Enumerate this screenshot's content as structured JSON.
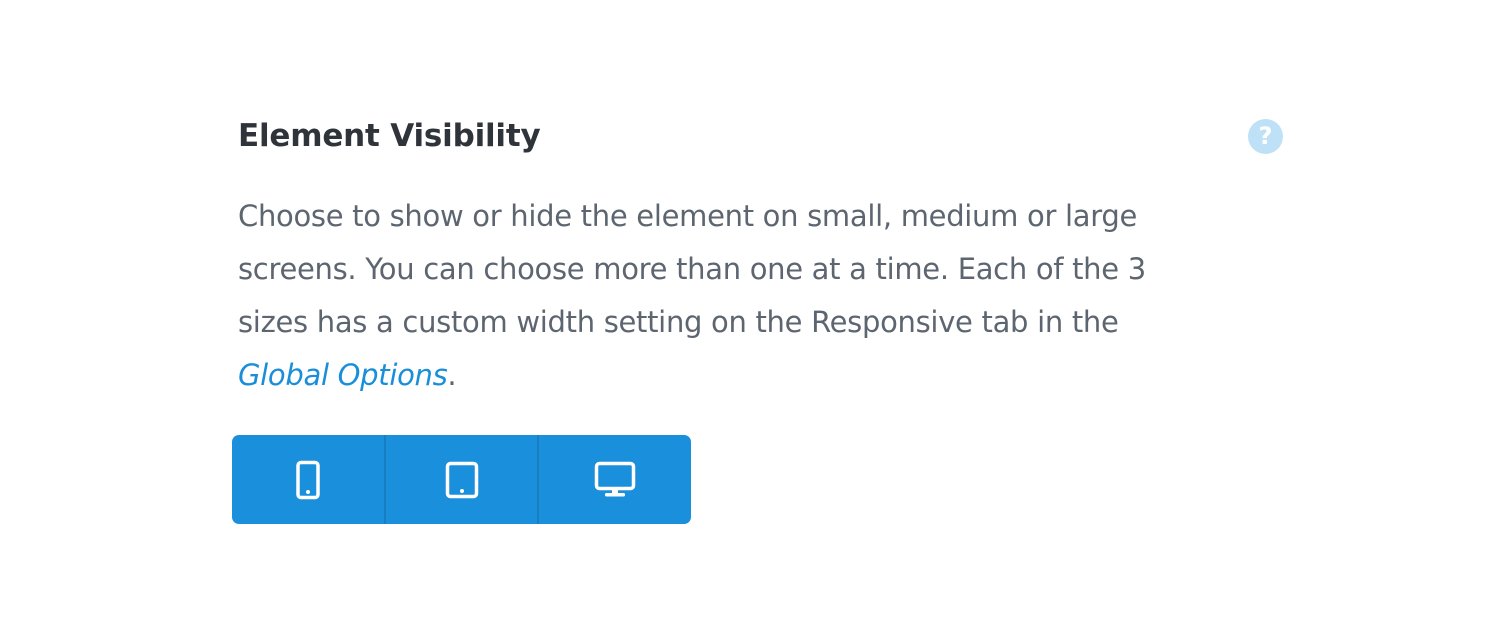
{
  "panel": {
    "title": "Element Visibility",
    "help_glyph": "?",
    "help_icon": "question-circle-icon",
    "description_lines": [
      "Choose to show or hide the element on small, medium or large",
      "screens. You can choose more than one at a time. Each of the 3",
      "sizes has a custom width setting on the Responsive tab in the"
    ],
    "link_text": "Global Options",
    "link_suffix": "."
  },
  "visibility_buttons": [
    {
      "size": "small",
      "icon": "mobile-icon"
    },
    {
      "size": "medium",
      "icon": "tablet-icon"
    },
    {
      "size": "large",
      "icon": "desktop-icon"
    }
  ],
  "colors": {
    "accent": "#1a8fdc",
    "divider": "#177ec2",
    "title": "#2f343a",
    "body_text": "#5d6670",
    "link": "#1a8fd9",
    "help_icon_bg": "#bfe1f7"
  }
}
